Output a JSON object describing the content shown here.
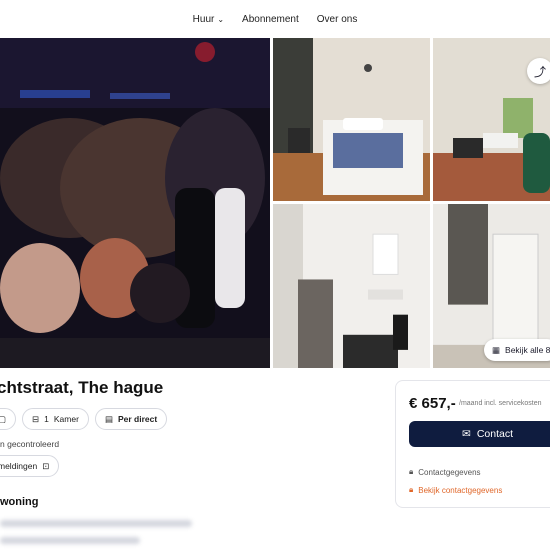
{
  "nav": {
    "items": [
      {
        "label": "Huur",
        "has_dropdown": true
      },
      {
        "label": "Abonnement",
        "has_dropdown": false
      },
      {
        "label": "Over ons",
        "has_dropdown": false
      }
    ]
  },
  "gallery": {
    "view_all_label": "Bekijk alle 8",
    "share_icon": "share-icon"
  },
  "listing": {
    "title": "chtstraat, The hague",
    "chips": [
      {
        "icon": "bed-icon",
        "value": "1",
        "label": "Kamer"
      },
      {
        "icon": "calendar-icon",
        "label": "Per direct"
      }
    ],
    "checked_text": "n gecontroleerd",
    "notifications_chip": "meldingen",
    "section_title": "woning",
    "description_blurred": true
  },
  "price_card": {
    "price": "€ 657,-",
    "price_sub": "/maand incl. servicekosten",
    "contact_label": "Contact",
    "contact_info_label": "Contactgegevens",
    "view_contact_label": "Bekijk contactgegevens",
    "accent_color": "#0f1c3f",
    "warning_color": "#e0672a"
  }
}
